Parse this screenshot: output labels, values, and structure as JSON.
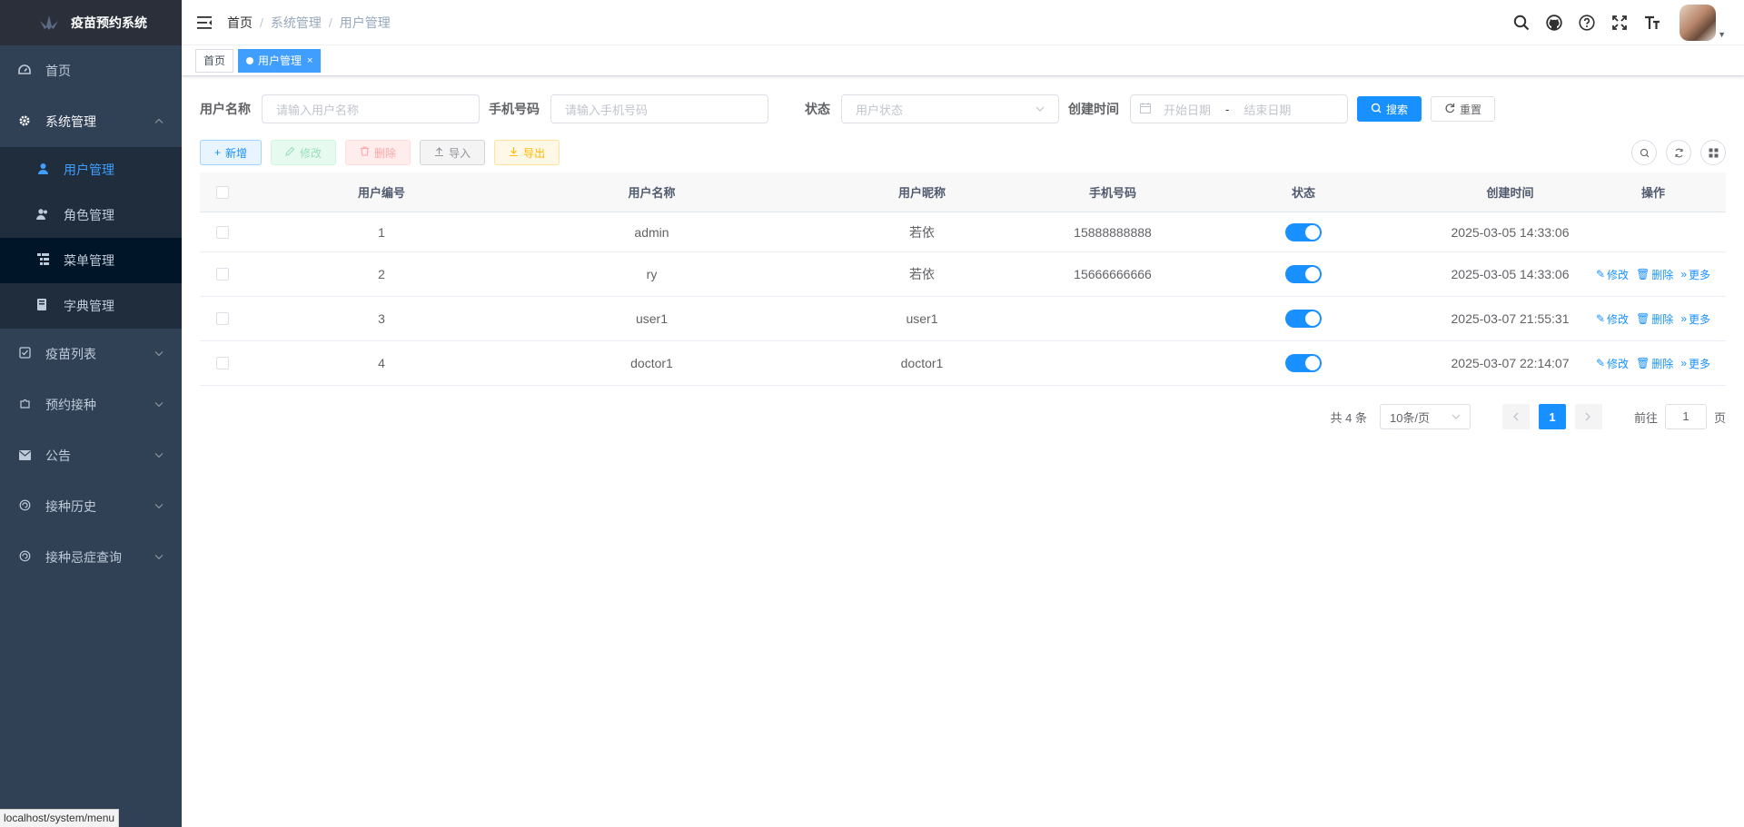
{
  "app": {
    "title": "疫苗预约系统"
  },
  "sidebar": {
    "items": [
      {
        "label": "首页"
      },
      {
        "label": "系统管理"
      },
      {
        "label": "疫苗列表"
      },
      {
        "label": "预约接种"
      },
      {
        "label": "公告"
      },
      {
        "label": "接种历史"
      },
      {
        "label": "接种忌症查询"
      }
    ],
    "sub_items": [
      {
        "label": "用户管理"
      },
      {
        "label": "角色管理"
      },
      {
        "label": "菜单管理"
      },
      {
        "label": "字典管理"
      }
    ]
  },
  "status_url": "localhost/system/menu",
  "breadcrumb": [
    "首页",
    "系统管理",
    "用户管理"
  ],
  "tags": [
    {
      "label": "首页"
    },
    {
      "label": "用户管理"
    }
  ],
  "search": {
    "username_label": "用户名称",
    "username_placeholder": "请输入用户名称",
    "phone_label": "手机号码",
    "phone_placeholder": "请输入手机号码",
    "status_label": "状态",
    "status_placeholder": "用户状态",
    "time_label": "创建时间",
    "start_placeholder": "开始日期",
    "range_sep": "-",
    "end_placeholder": "结束日期",
    "search_btn": "搜索",
    "reset_btn": "重置"
  },
  "toolbar": {
    "add": "新增",
    "edit": "修改",
    "delete": "删除",
    "import": "导入",
    "export": "导出"
  },
  "table": {
    "columns": [
      "用户编号",
      "用户名称",
      "用户昵称",
      "手机号码",
      "状态",
      "创建时间",
      "操作"
    ],
    "rows": [
      {
        "id": "1",
        "username": "admin",
        "nickname": "若依",
        "phone": "15888888888",
        "status": true,
        "created": "2025-03-05 14:33:06",
        "ops": []
      },
      {
        "id": "2",
        "username": "ry",
        "nickname": "若依",
        "phone": "15666666666",
        "status": true,
        "created": "2025-03-05 14:33:06",
        "ops": [
          "修改",
          "删除",
          "更多"
        ]
      },
      {
        "id": "3",
        "username": "user1",
        "nickname": "user1",
        "phone": "",
        "status": true,
        "created": "2025-03-07 21:55:31",
        "ops": [
          "修改",
          "删除",
          "更多"
        ]
      },
      {
        "id": "4",
        "username": "doctor1",
        "nickname": "doctor1",
        "phone": "",
        "status": true,
        "created": "2025-03-07 22:14:07",
        "ops": [
          "修改",
          "删除",
          "更多"
        ]
      }
    ]
  },
  "pagination": {
    "total": "共 4 条",
    "page_size": "10条/页",
    "current": "1",
    "goto": "前往",
    "goto_value": "1",
    "page_unit": "页"
  },
  "colors": {
    "sidebar_bg": "#304156",
    "submenu_bg": "#1f2d3d",
    "primary": "#1890ff",
    "active_menu": "#409eff"
  }
}
